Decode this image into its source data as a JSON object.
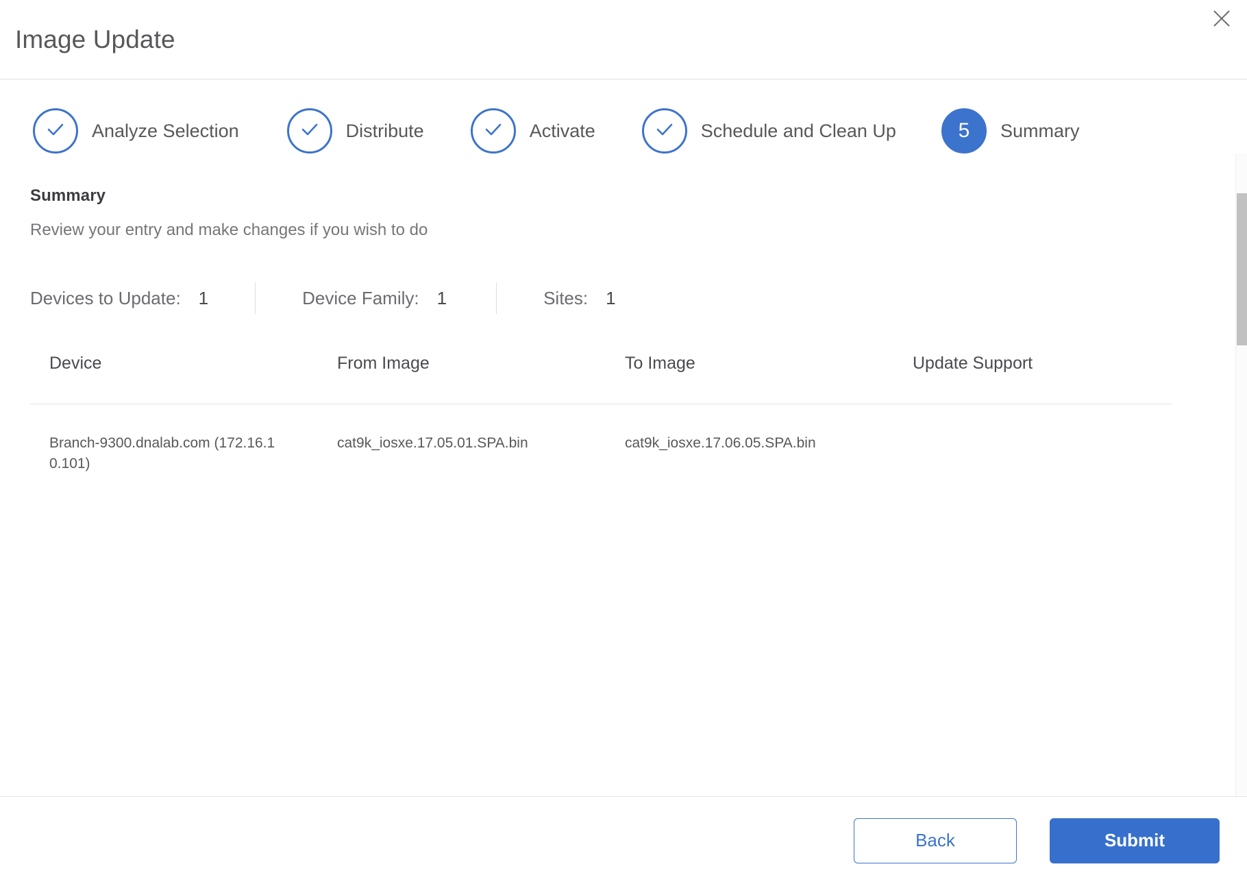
{
  "dialog": {
    "title": "Image Update",
    "close_icon": "close-icon"
  },
  "stepper": {
    "steps": [
      {
        "number": "1",
        "label": "Analyze Selection",
        "state": "done",
        "icon": "check-icon"
      },
      {
        "number": "2",
        "label": "Distribute",
        "state": "done",
        "icon": "check-icon"
      },
      {
        "number": "3",
        "label": "Activate",
        "state": "done",
        "icon": "check-icon"
      },
      {
        "number": "4",
        "label": "Schedule and Clean Up",
        "state": "done",
        "icon": "check-icon"
      },
      {
        "number": "5",
        "label": "Summary",
        "state": "current",
        "icon": ""
      }
    ],
    "accent_color": "#3c73cc"
  },
  "section": {
    "title": "Summary",
    "subtitle": "Review your entry and make changes if you wish to do"
  },
  "stats": [
    {
      "label": "Devices to Update:",
      "value": "1"
    },
    {
      "label": "Device Family:",
      "value": "1"
    },
    {
      "label": "Sites:",
      "value": "1"
    }
  ],
  "table": {
    "columns": [
      "Device",
      "From Image",
      "To Image",
      "Update Support"
    ],
    "rows": [
      {
        "device": "Branch-9300.dnalab.com (172.16.10.101)",
        "from_image": "cat9k_iosxe.17.05.01.SPA.bin",
        "to_image": "cat9k_iosxe.17.06.05.SPA.bin",
        "update_support": ""
      }
    ]
  },
  "footer": {
    "back_label": "Back",
    "submit_label": "Submit"
  },
  "colors": {
    "accent": "#3c73cc",
    "primary_button": "#3670cc",
    "text": "#58585b"
  }
}
